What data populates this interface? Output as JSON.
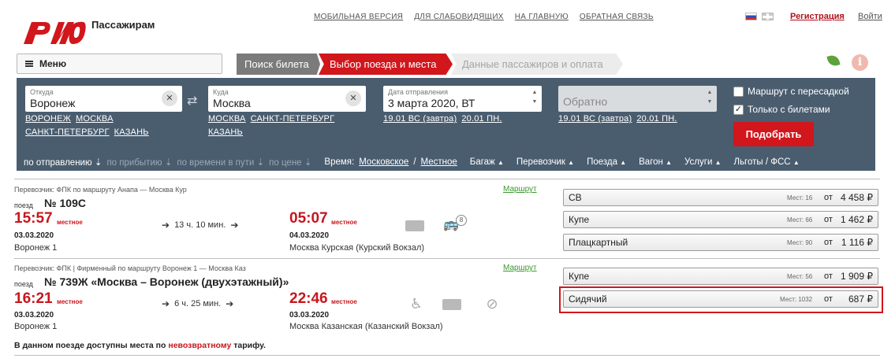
{
  "header": {
    "brand_title": "Пассажирам",
    "links": [
      "МОБИЛЬНАЯ ВЕРСИЯ",
      "ДЛЯ СЛАБОВИДЯЩИХ",
      "НА ГЛАВНУЮ",
      "ОБРАТНАЯ СВЯЗЬ"
    ],
    "register": "Регистрация",
    "login": "Войти"
  },
  "menu": {
    "label": "Меню"
  },
  "steps": [
    "Поиск билета",
    "Выбор поезда и места",
    "Данные пассажиров и оплата"
  ],
  "search": {
    "from_label": "Откуда",
    "from_value": "Воронеж",
    "from_quick": [
      "ВОРОНЕЖ",
      "МОСКВА",
      "САНКТ-ПЕТЕРБУРГ",
      "КАЗАНЬ"
    ],
    "to_label": "Куда",
    "to_value": "Москва",
    "to_quick": [
      "МОСКВА",
      "САНКТ-ПЕТЕРБУРГ",
      "КАЗАНЬ"
    ],
    "date_label": "Дата отправления",
    "date_value": "3 марта 2020, ВТ",
    "date_quick": [
      "19.01 ВС (завтра)",
      "20.01 ПН."
    ],
    "return_placeholder": "Обратно",
    "return_quick": [
      "19.01 ВС (завтра)",
      "20.01 ПН."
    ],
    "transfer_label": "Маршрут с пересадкой",
    "tickets_only_label": "Только с билетами",
    "submit": "Подобрать"
  },
  "sortbar": {
    "by_departure": "по отправлению",
    "by_arrival": "по прибытию",
    "by_travel_time": "по времени в пути",
    "by_price": "по цене",
    "time_label": "Время:",
    "time_moscow": "Московское",
    "time_slash": "/",
    "time_local": "Местное",
    "filters": [
      "Багаж",
      "Перевозчик",
      "Поезда",
      "Вагон",
      "Услуги",
      "Льготы / ФСС"
    ]
  },
  "trains": [
    {
      "carrier": "Перевозчик: ФПК   по маршруту Анапа — Москва Кур",
      "route_link": "Маршрут",
      "train_label": "поезд",
      "number": "№ 109С",
      "dep_time": "15:57",
      "dep_tz": "местное",
      "dep_date": "03.03.2020",
      "dep_station": "Воронеж 1",
      "duration": "13 ч. 10 мин.",
      "arr_time": "05:07",
      "arr_tz": "местное",
      "arr_date": "04.03.2020",
      "arr_station": "Москва Курская (Курский Вокзал)",
      "badge": "8",
      "fares": [
        {
          "class": "СВ",
          "seats_label": "Мест: 16",
          "from": "от",
          "price": "4 458 ₽"
        },
        {
          "class": "Купе",
          "seats_label": "Мест: 66",
          "from": "от",
          "price": "1 462 ₽"
        },
        {
          "class": "Плацкартный",
          "seats_label": "Мест: 90",
          "from": "от",
          "price": "1 116 ₽"
        }
      ]
    },
    {
      "carrier": "Перевозчик: ФПК | Фирменный   по маршруту Воронеж 1 — Москва Каз",
      "route_link": "Маршрут",
      "train_label": "поезд",
      "number": "№ 739Ж «Москва – Воронеж (двухэтажный)»",
      "dep_time": "16:21",
      "dep_tz": "местное",
      "dep_date": "03.03.2020",
      "dep_station": "Воронеж 1",
      "duration": "6 ч. 25 мин.",
      "arr_time": "22:46",
      "arr_tz": "местное",
      "arr_date": "03.03.2020",
      "arr_station": "Москва Казанская (Казанский Вокзал)",
      "fares": [
        {
          "class": "Купе",
          "seats_label": "Мест: 56",
          "from": "от",
          "price": "1 909 ₽"
        },
        {
          "class": "Сидячий",
          "seats_label": "Мест: 1032",
          "from": "от",
          "price": "687 ₽"
        }
      ],
      "note_prefix": "В данном поезде доступны места по ",
      "note_red": "невозвратному",
      "note_suffix": " тарифу."
    }
  ],
  "colors": {
    "brand_red": "#d1161c",
    "panel": "#4a5d6f",
    "link_green": "#3a9a2c"
  }
}
